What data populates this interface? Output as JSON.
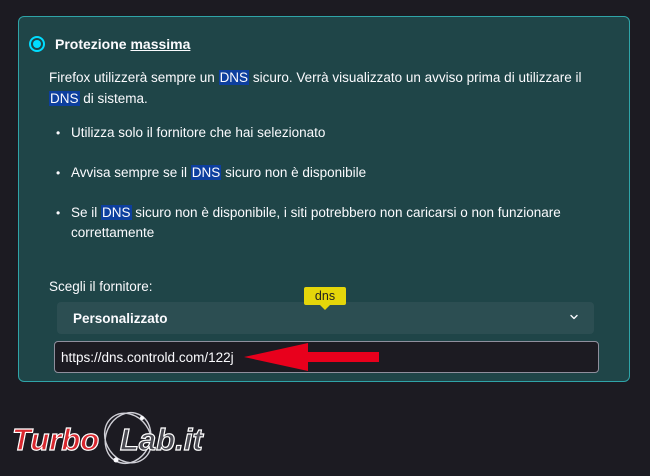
{
  "option": {
    "label_before": "Protezione ",
    "label_underlined": "massima",
    "selected": true,
    "description": {
      "part1": "Firefox utilizzerà sempre un ",
      "dns1": "DNS",
      "part2": " sicuro. Verrà visualizzato un avviso prima di utilizzare il ",
      "dns2": "DNS",
      "part3": " di sistema."
    },
    "bullets": [
      {
        "text": "Utilizza solo il fornitore che hai selezionato"
      },
      {
        "before": "Avvisa sempre se il ",
        "dns": "DNS",
        "after": " sicuro non è disponibile"
      },
      {
        "before": "Se il ",
        "dns": "DNS",
        "after": " sicuro non è disponibile, i siti potrebbero non caricarsi o non funzionare correttamente"
      }
    ]
  },
  "provider": {
    "label": "Scegli il fornitore:",
    "tooltip": "dns",
    "selected_value": "Personalizzato",
    "custom_url": "https://dns.controld.com/122j"
  },
  "watermark": {
    "text_turbo": "Turbo",
    "text_lab": "Lab.it"
  },
  "colors": {
    "panel_bg": "#1f4548",
    "panel_border": "#2fa4a8",
    "accent": "#00ddff",
    "dns_highlight": "#0d3f9e",
    "tooltip_bg": "#e5d60a",
    "arrow": "#e8001c"
  }
}
